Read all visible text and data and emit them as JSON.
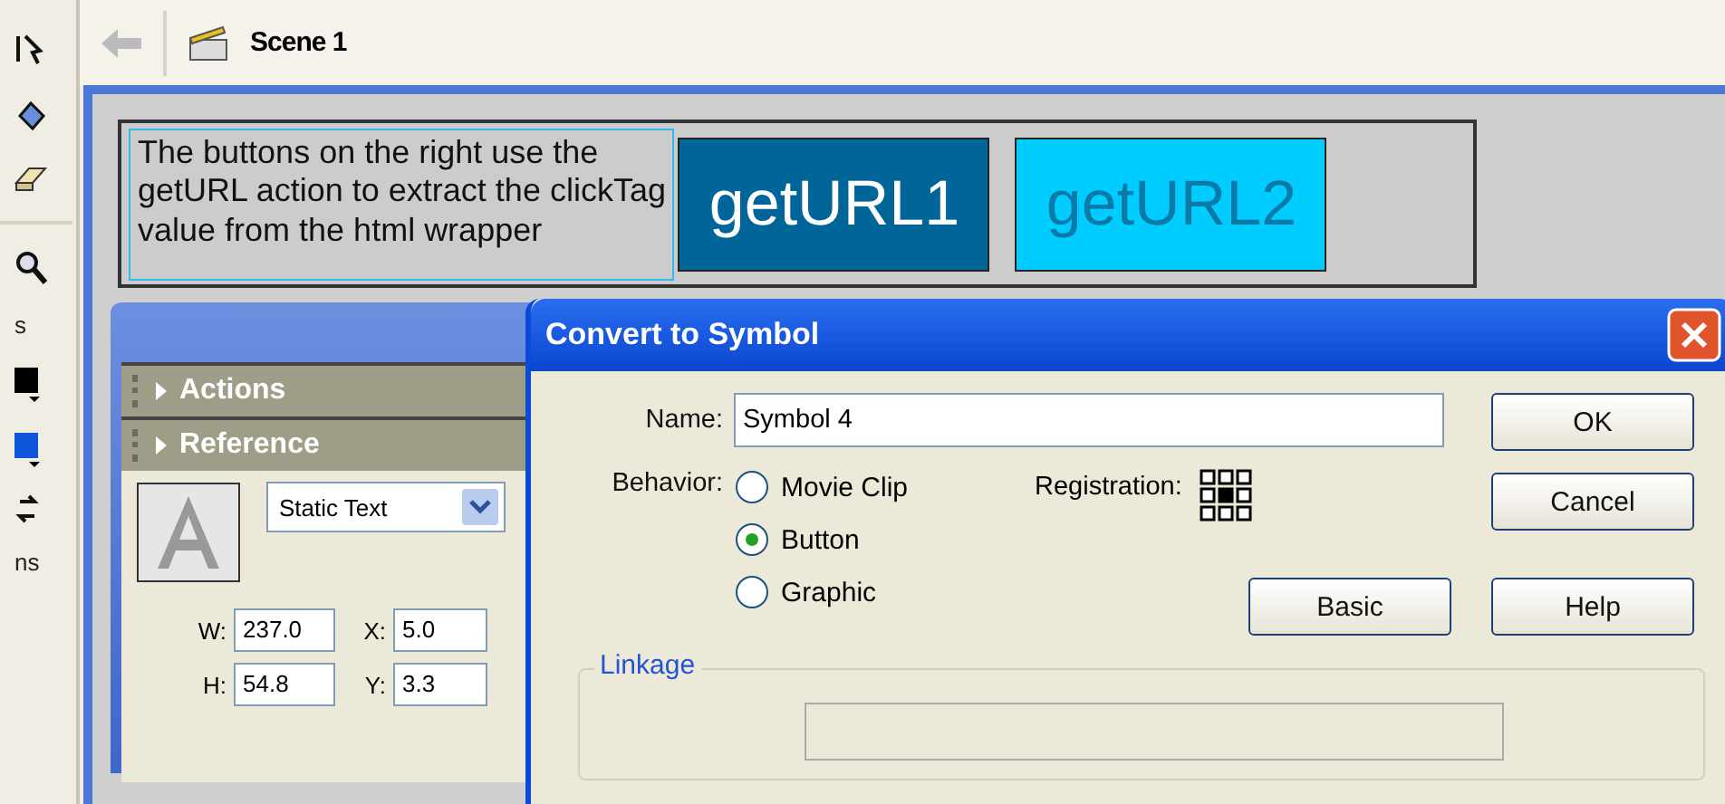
{
  "toolbar": {
    "labels": [
      "s",
      "ns"
    ]
  },
  "header": {
    "scene": "Scene 1"
  },
  "stage": {
    "description": "The buttons on the right use the\ngetURL action to extract the clickTag\nvalue from the html wrapper",
    "buttons": [
      {
        "label": "getURL1",
        "kind": "dark"
      },
      {
        "label": "getURL2",
        "kind": "light"
      }
    ]
  },
  "panels": [
    {
      "label": "Actions",
      "expanded": false
    },
    {
      "label": "Reference",
      "expanded": false
    }
  ],
  "properties": {
    "text_type": "Static Text",
    "fields": [
      {
        "label": "W:",
        "value": "237.0"
      },
      {
        "label": "X:",
        "value": "5.0"
      },
      {
        "label": "H:",
        "value": "54.8"
      },
      {
        "label": "Y:",
        "value": "3.3"
      }
    ]
  },
  "dialog": {
    "title": "Convert to Symbol",
    "name_label": "Name:",
    "name_value": "Symbol 4",
    "behavior_label": "Behavior:",
    "behaviors": [
      {
        "label": "Movie Clip",
        "selected": false
      },
      {
        "label": "Button",
        "selected": true
      },
      {
        "label": "Graphic",
        "selected": false
      }
    ],
    "registration_label": "Registration:",
    "buttons": [
      "OK",
      "Cancel",
      "Basic",
      "Help"
    ],
    "linkage_label": "Linkage"
  }
}
